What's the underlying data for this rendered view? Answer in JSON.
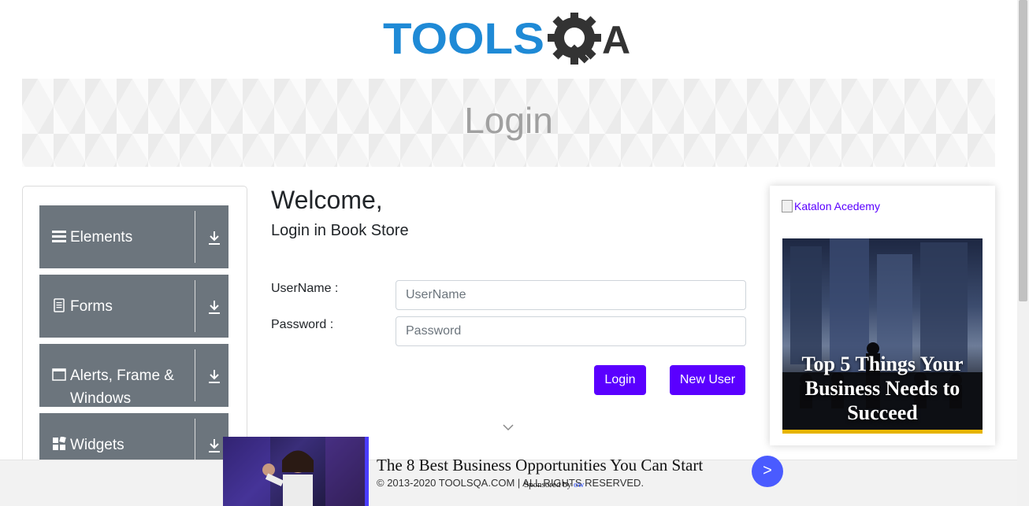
{
  "header": {
    "logo_text_main": "TOOLS",
    "logo_text_q": "Q",
    "logo_text_a": "A"
  },
  "banner": {
    "title": "Login"
  },
  "sidebar": {
    "groups": [
      {
        "label": "Elements",
        "icon": "hamburger-icon"
      },
      {
        "label": "Forms",
        "icon": "document-icon"
      },
      {
        "label": "Alerts, Frame & Windows",
        "icon": "window-icon"
      },
      {
        "label": "Widgets",
        "icon": "widgets-icon"
      }
    ]
  },
  "main": {
    "welcome": "Welcome,",
    "subtitle": "Login in Book Store",
    "username_label": "UserName :",
    "username_placeholder": "UserName",
    "username_value": "",
    "password_label": "Password :",
    "password_placeholder": "Password",
    "password_value": "",
    "login_button": "Login",
    "new_user_button": "New User"
  },
  "right_ad": {
    "image_alt": "Katalon Acedemy",
    "ad_text": "Top 5 Things Your Business Needs to Succeed"
  },
  "footer": {
    "copyright": "© 2013-2020 TOOLSQA.COM | ALL RIGHTS RESERVED."
  },
  "bottom_ad": {
    "headline": "The 8 Best Business Opportunities You Can Start",
    "sponsored_prefix": "Sponsored by",
    "sponsored_brand": "ow",
    "arrow": ">"
  },
  "colors": {
    "logo_blue": "#1f8ad6",
    "logo_dark": "#333333",
    "button_purple": "#5a00ff",
    "sidebar_gray": "#6c757d",
    "banner_title_gray": "#a0a0a0"
  }
}
